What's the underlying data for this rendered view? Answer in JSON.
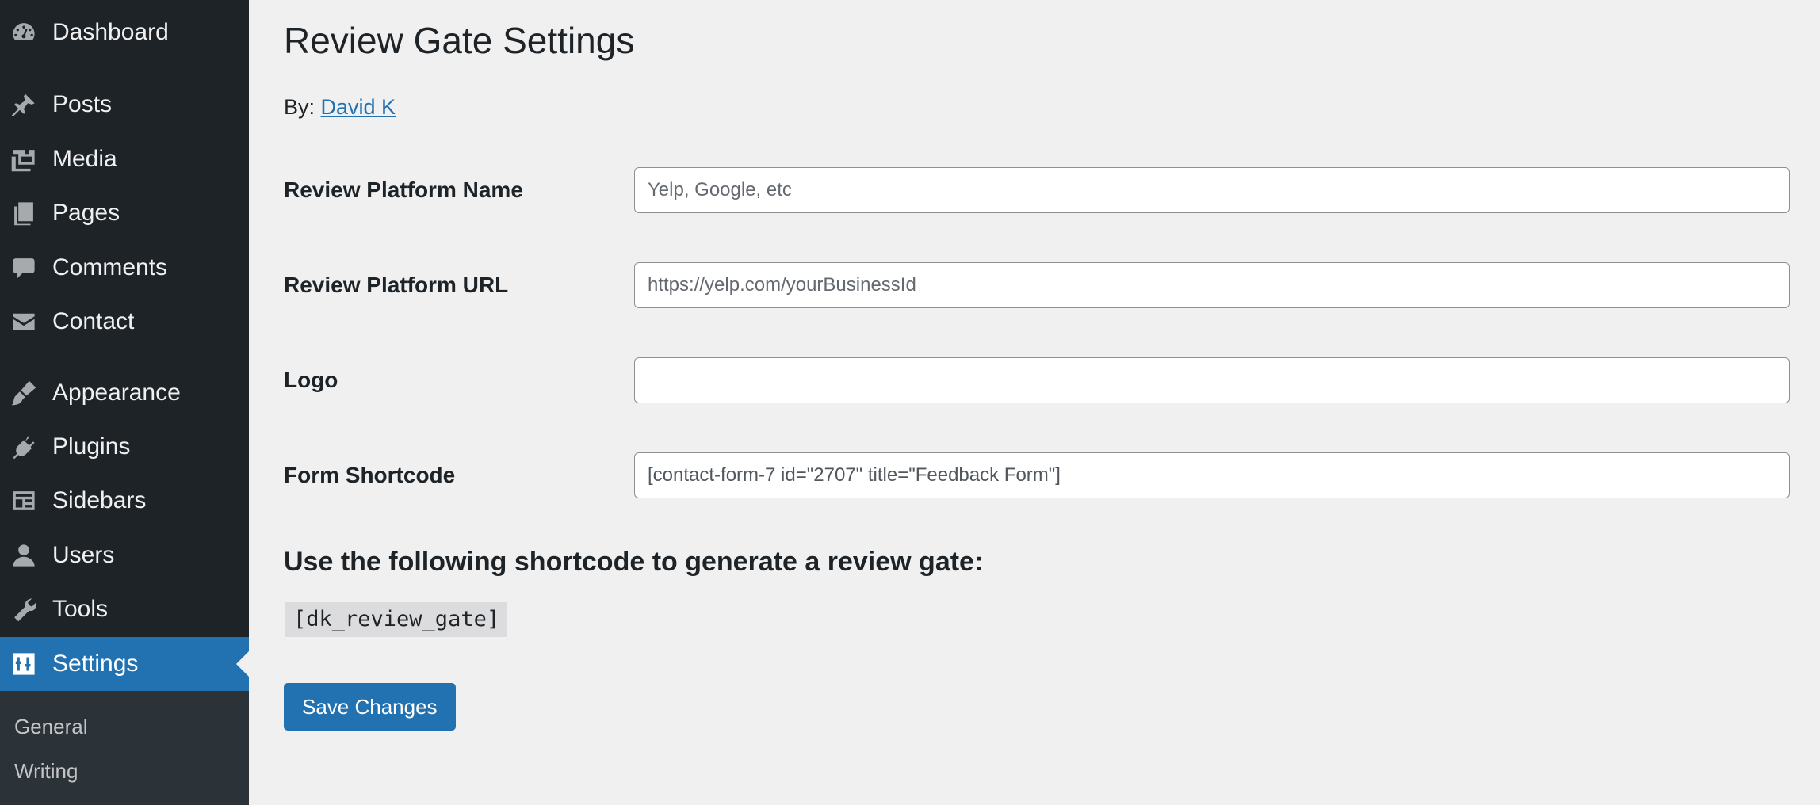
{
  "sidebar": {
    "items": [
      {
        "label": "Dashboard",
        "icon": "dashboard-icon"
      },
      {
        "label": "Posts",
        "icon": "pin-icon"
      },
      {
        "label": "Media",
        "icon": "media-icon"
      },
      {
        "label": "Pages",
        "icon": "pages-icon"
      },
      {
        "label": "Comments",
        "icon": "comment-icon"
      },
      {
        "label": "Contact",
        "icon": "envelope-icon"
      },
      {
        "label": "Appearance",
        "icon": "brush-icon"
      },
      {
        "label": "Plugins",
        "icon": "plug-icon"
      },
      {
        "label": "Sidebars",
        "icon": "layout-icon"
      },
      {
        "label": "Users",
        "icon": "user-icon"
      },
      {
        "label": "Tools",
        "icon": "wrench-icon"
      },
      {
        "label": "Settings",
        "icon": "sliders-icon",
        "active": true
      }
    ],
    "submenu": [
      {
        "label": "General"
      },
      {
        "label": "Writing"
      }
    ]
  },
  "page": {
    "title": "Review Gate Settings",
    "by_prefix": "By:",
    "author": "David K"
  },
  "form": {
    "platform_name": {
      "label": "Review Platform Name",
      "value": "",
      "placeholder": "Yelp, Google, etc"
    },
    "platform_url": {
      "label": "Review Platform URL",
      "value": "",
      "placeholder": "https://yelp.com/yourBusinessId"
    },
    "logo": {
      "label": "Logo",
      "value": "",
      "placeholder": ""
    },
    "form_shortcode": {
      "label": "Form Shortcode",
      "value": "[contact-form-7 id=\"2707\" title=\"Feedback Form\"]",
      "placeholder": ""
    }
  },
  "shortcode_section": {
    "heading": "Use the following shortcode to generate a review gate:",
    "code": "[dk_review_gate]"
  },
  "actions": {
    "save_label": "Save Changes"
  },
  "colors": {
    "sidebar_bg": "#1d2327",
    "accent": "#2271b1",
    "page_bg": "#f0f0f1"
  }
}
